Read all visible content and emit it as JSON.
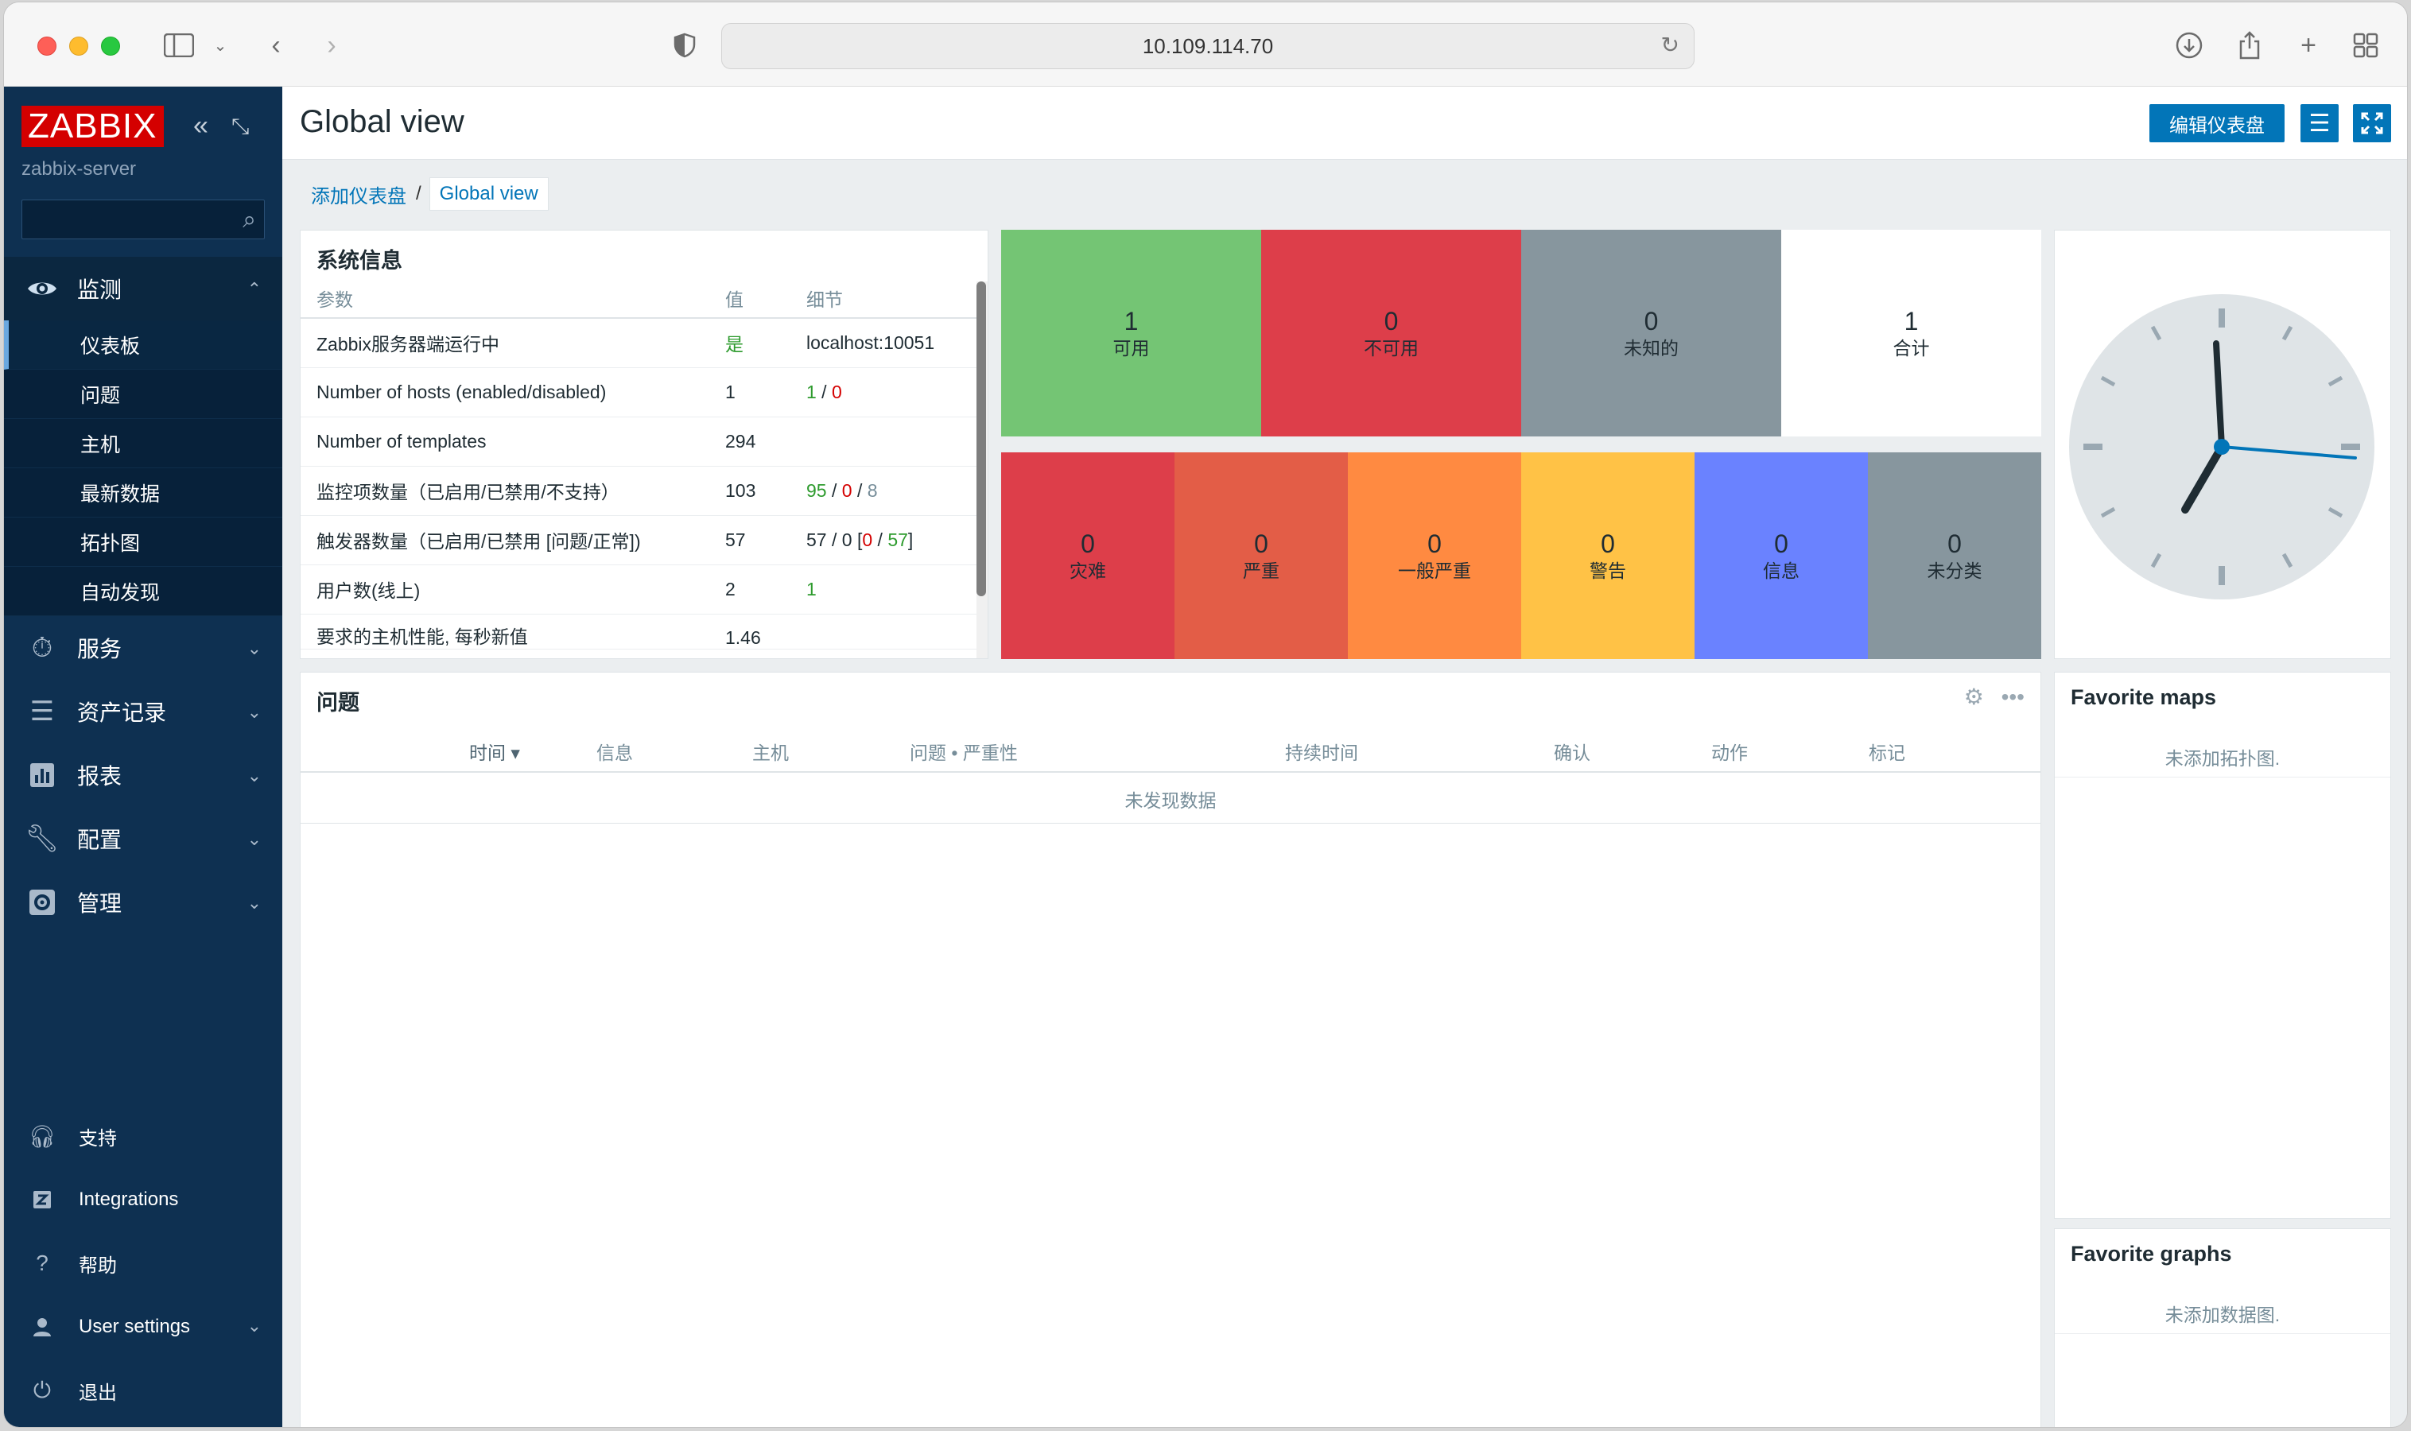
{
  "browser": {
    "url": "10.109.114.70"
  },
  "sidebar": {
    "logo": "ZABBIX",
    "server": "zabbix-server",
    "menu": [
      {
        "label": "监测",
        "icon": "eye-icon"
      },
      {
        "label": "服务",
        "icon": "stopwatch-icon"
      },
      {
        "label": "资产记录",
        "icon": "list-icon"
      },
      {
        "label": "报表",
        "icon": "chart-icon"
      },
      {
        "label": "配置",
        "icon": "wrench-icon"
      },
      {
        "label": "管理",
        "icon": "gear-icon"
      }
    ],
    "submenu": [
      "仪表板",
      "问题",
      "主机",
      "最新数据",
      "拓扑图",
      "自动发现"
    ],
    "bottom": [
      {
        "label": "支持",
        "icon": "headset-icon"
      },
      {
        "label": "Integrations",
        "icon": "integrations-icon"
      },
      {
        "label": "帮助",
        "icon": "help-icon"
      },
      {
        "label": "User settings",
        "icon": "user-icon"
      },
      {
        "label": "退出",
        "icon": "power-icon"
      }
    ]
  },
  "header": {
    "title": "Global view",
    "edit_button": "编辑仪表盘"
  },
  "breadcrumb": {
    "parent": "添加仪表盘",
    "separator": "/",
    "current": "Global view"
  },
  "system_info": {
    "title": "系统信息",
    "columns": [
      "参数",
      "值",
      "细节"
    ],
    "rows": [
      {
        "param": "Zabbix服务器端运行中",
        "value": "是",
        "details": "localhost:10051"
      },
      {
        "param": "Number of hosts (enabled/disabled)",
        "value": "1",
        "d1": "1",
        "d2": "0"
      },
      {
        "param": "Number of templates",
        "value": "294"
      },
      {
        "param": "监控项数量（已启用/已禁用/不支持）",
        "value": "103",
        "d1": "95",
        "d2": "0",
        "d3": "8"
      },
      {
        "param": "触发器数量（已启用/已禁用 [问题/正常])",
        "value": "57",
        "d1": "57",
        "d2": "0",
        "d3": "0",
        "d4": "57"
      },
      {
        "param": "用户数(线上)",
        "value": "2",
        "d1": "1"
      },
      {
        "param": "要求的主机性能, 每秒新值",
        "value": "1.46"
      }
    ]
  },
  "host_availability": [
    {
      "count": "1",
      "label": "可用",
      "color": "#74c574"
    },
    {
      "count": "0",
      "label": "不可用",
      "color": "#dd3e4a"
    },
    {
      "count": "0",
      "label": "未知的",
      "color": "#87969e"
    },
    {
      "count": "1",
      "label": "合计",
      "color": "#ffffff"
    }
  ],
  "problems_by_severity": [
    {
      "count": "0",
      "label": "灾难",
      "color": "#dd3e4a"
    },
    {
      "count": "0",
      "label": "严重",
      "color": "#e35d47"
    },
    {
      "count": "0",
      "label": "一般严重",
      "color": "#ff8a41"
    },
    {
      "count": "0",
      "label": "警告",
      "color": "#ffc246"
    },
    {
      "count": "0",
      "label": "信息",
      "color": "#6a82ff"
    },
    {
      "count": "0",
      "label": "未分类",
      "color": "#87969e"
    }
  ],
  "problems": {
    "title": "问题",
    "columns": [
      "时间 ▾",
      "信息",
      "主机",
      "问题 • 严重性",
      "持续时间",
      "确认",
      "动作",
      "标记"
    ],
    "empty": "未发现数据"
  },
  "favorite_maps": {
    "title": "Favorite maps",
    "empty": "未添加拓扑图."
  },
  "favorite_graphs": {
    "title": "Favorite graphs",
    "empty": "未添加数据图."
  },
  "colors": {
    "sidebar": "#0e3051",
    "accent": "#0275b8",
    "ok": "#2e9b2e",
    "problem": "#d40000"
  }
}
